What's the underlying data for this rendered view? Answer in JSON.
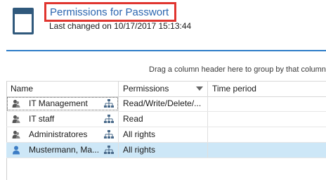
{
  "header": {
    "title": "Permissions for Passwort",
    "subtitle": "Last changed on 10/17/2017 15:13:44",
    "icon": "document-icon",
    "title_highlight_color": "#e0352f",
    "title_color": "#2c66b0"
  },
  "grid": {
    "group_panel_text": "Drag a column header here to group by that column",
    "columns": [
      "Name",
      "Permissions",
      "Time period"
    ],
    "rows": [
      {
        "name": "IT Management",
        "permissions": "Read/Write/Delete/...",
        "time_period": "",
        "icon": "user-group-icon",
        "focused": true,
        "selected": false
      },
      {
        "name": "IT staff",
        "permissions": "Read",
        "time_period": "",
        "icon": "user-group-icon",
        "focused": false,
        "selected": false
      },
      {
        "name": "Administratores",
        "permissions": "All rights",
        "time_period": "",
        "icon": "user-group-icon",
        "focused": false,
        "selected": false
      },
      {
        "name": "Mustermann, Ma...",
        "permissions": "All rights",
        "time_period": "",
        "icon": "user-icon",
        "focused": false,
        "selected": true
      }
    ],
    "accent_color": "#2d7cc8",
    "selected_row_color": "#cde7f7"
  }
}
